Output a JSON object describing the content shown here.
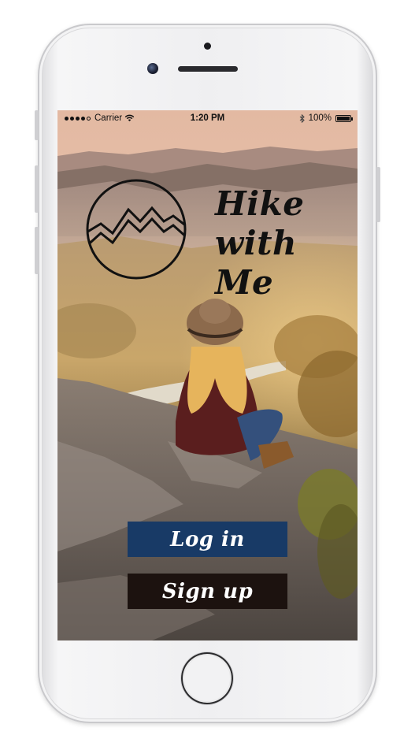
{
  "status_bar": {
    "carrier": "Carrier",
    "time": "1:20 PM",
    "battery": "100%"
  },
  "app": {
    "title_line1": "Hike",
    "title_line2": "with Me"
  },
  "buttons": {
    "login_label": "Log in",
    "signup_label": "Sign up"
  },
  "colors": {
    "login_button": "#183a66",
    "signup_button": "#1c120f"
  },
  "icons": {
    "logo": "mountain-logo-icon",
    "wifi": "wifi-icon",
    "bluetooth": "bluetooth-icon",
    "battery": "battery-icon"
  }
}
